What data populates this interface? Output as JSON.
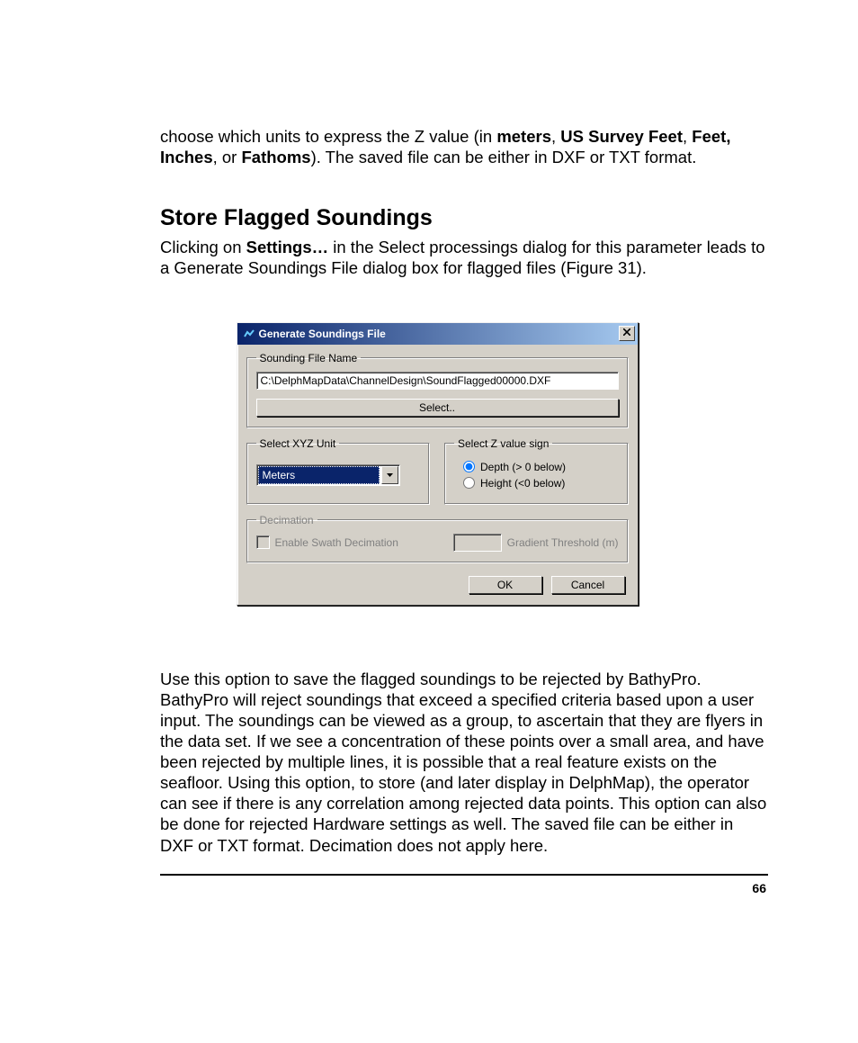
{
  "intro_paragraph": {
    "pre": "choose which units to express the Z value (in ",
    "u1": "meters",
    "sep1": ", ",
    "u2": "US Survey Feet",
    "sep2": ", ",
    "u3": "Feet, Inches",
    "sep3": ", or ",
    "u4": "Fathoms",
    "post": "). The saved file can be either in DXF or TXT format."
  },
  "heading": "Store Flagged Soundings",
  "para2": {
    "pre": "Clicking on ",
    "bold": "Settings…",
    "post": " in the Select processings dialog for this parameter leads to a Generate Soundings File dialog box for flagged files (Figure 31)."
  },
  "dialog": {
    "title": "Generate Soundings File",
    "group_file": "Sounding File Name",
    "file_path": "C:\\DelphMapData\\ChannelDesign\\SoundFlagged00000.DXF",
    "select_btn": "Select..",
    "group_unit": "Select XYZ Unit",
    "unit_value": "Meters",
    "group_sign": "Select Z  value sign",
    "radio_depth": "Depth (> 0 below)",
    "radio_height": "Height (<0 below)",
    "group_decim": "Decimation",
    "decim_check": "Enable Swath Decimation",
    "decim_threshold": "Gradient Threshold (m)",
    "ok": "OK",
    "cancel": "Cancel"
  },
  "para3": "Use this option to save the flagged soundings to be rejected by BathyPro. BathyPro will reject soundings that exceed a specified criteria based upon a user input. The soundings can be viewed as a group, to ascertain that they are flyers in the data set. If we see a concentration of these points over a small area, and have been rejected by multiple lines, it is possible that a real feature exists on the seafloor. Using this option, to store (and later display in DelphMap), the operator can see if there is any correlation among rejected data points.  This option can also be done for rejected Hardware settings as well. The saved file can be either in DXF or TXT format. Decimation does not apply here.",
  "page_number": "66"
}
